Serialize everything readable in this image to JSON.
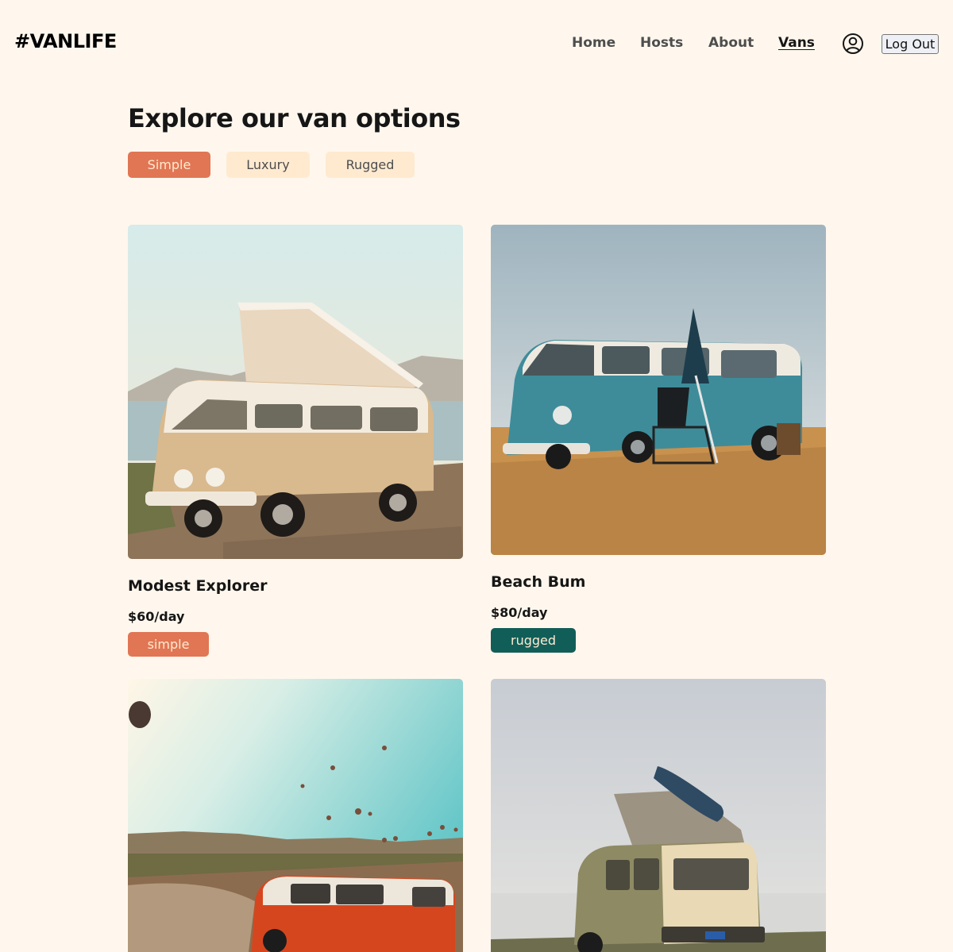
{
  "header": {
    "logo": "#VANLIFE",
    "nav": [
      "Home",
      "Hosts",
      "About",
      "Vans"
    ],
    "active_nav": "Vans",
    "logout_label": "Log Out"
  },
  "main": {
    "title": "Explore our van options",
    "filters": [
      "Simple",
      "Luxury",
      "Rugged"
    ],
    "active_filter": "Simple"
  },
  "vans": [
    {
      "name": "Modest Explorer",
      "price": "$60",
      "per": "/day",
      "type": "simple",
      "type_color": "#E17654"
    },
    {
      "name": "Beach Bum",
      "price": "$80",
      "per": "/day",
      "type": "rugged",
      "type_color": "#115E59"
    },
    {
      "name": "",
      "price": "",
      "per": "",
      "type": ""
    },
    {
      "name": "",
      "price": "",
      "per": "",
      "type": ""
    }
  ],
  "colors": {
    "background": "#FFF7ED",
    "simple": "#E17654",
    "rugged": "#115E59",
    "filter_inactive": "#FFEAD0"
  },
  "icons": {
    "user": "user-circle-icon"
  }
}
